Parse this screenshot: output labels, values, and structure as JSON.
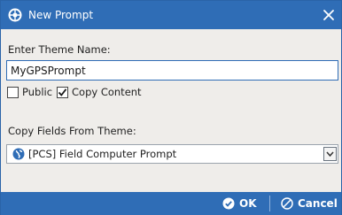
{
  "window": {
    "title": "New Prompt",
    "icon": "app-logo-icon",
    "close_icon": "close-icon"
  },
  "form": {
    "theme_name_label": "Enter Theme Name:",
    "theme_name_value": "MyGPSPrompt",
    "public_label": "Public",
    "public_checked": false,
    "copy_content_label": "Copy Content",
    "copy_content_checked": true,
    "copy_fields_label": "Copy Fields From Theme:",
    "copy_fields_value": "[PCS] Field Computer Prompt",
    "copy_fields_icon": "globe-icon"
  },
  "footer": {
    "ok_label": "OK",
    "cancel_label": "Cancel"
  },
  "colors": {
    "titlebar": "#2f6db6",
    "body": "#efedea",
    "footer": "#2f6db6"
  }
}
